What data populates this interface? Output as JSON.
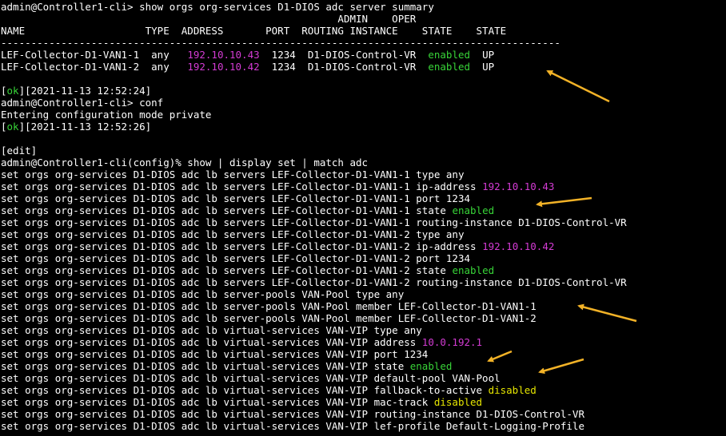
{
  "colors": {
    "background": "#000000",
    "text": "#ffffff",
    "ip_magenta": "#d33bd3",
    "enabled_green": "#38d438",
    "disabled_yellow": "#e6e600",
    "arrow_orange": "#f2b227"
  },
  "summary": {
    "command": "admin@Controller1-cli> show orgs org-services D1-DIOS adc server summary",
    "header1": "                                                        ADMIN    OPER",
    "header2": "NAME                    TYPE  ADDRESS       PORT  ROUTING INSTANCE    STATE    STATE",
    "separator": "---------------------------------------------------------------------------------------------",
    "rows": [
      {
        "name": "LEF-Collector-D1-VAN1-1  ",
        "type": "any   ",
        "address": "192.10.10.43",
        "port": "  1234  ",
        "ri": "D1-DIOS-Control-VR  ",
        "admin": "enabled",
        "oper": "  UP"
      },
      {
        "name": "LEF-Collector-D1-VAN1-2  ",
        "type": "any   ",
        "address": "192.10.10.42",
        "port": "  1234  ",
        "ri": "D1-DIOS-Control-VR  ",
        "admin": "enabled",
        "oper": "  UP"
      }
    ]
  },
  "ok1": {
    "bracket_open": "[",
    "ok": "ok",
    "rest": "][2021-11-13 12:52:24]"
  },
  "conf_cmd": "admin@Controller1-cli> conf",
  "entering": "Entering configuration mode private",
  "ok2": {
    "bracket_open": "[",
    "ok": "ok",
    "rest": "][2021-11-13 12:52:26]"
  },
  "edit": "[edit]",
  "match_cmd": "admin@Controller1-cli(config)% show | display set | match adc",
  "set_lines": [
    {
      "text": "set orgs org-services D1-DIOS adc lb servers LEF-Collector-D1-VAN1-1 type any",
      "value": "",
      "vclass": ""
    },
    {
      "text": "set orgs org-services D1-DIOS adc lb servers LEF-Collector-D1-VAN1-1 ip-address ",
      "value": "192.10.10.43",
      "vclass": "m"
    },
    {
      "text": "set orgs org-services D1-DIOS adc lb servers LEF-Collector-D1-VAN1-1 port 1234",
      "value": "",
      "vclass": ""
    },
    {
      "text": "set orgs org-services D1-DIOS adc lb servers LEF-Collector-D1-VAN1-1 state ",
      "value": "enabled",
      "vclass": "g"
    },
    {
      "text": "set orgs org-services D1-DIOS adc lb servers LEF-Collector-D1-VAN1-1 routing-instance D1-DIOS-Control-VR",
      "value": "",
      "vclass": ""
    },
    {
      "text": "set orgs org-services D1-DIOS adc lb servers LEF-Collector-D1-VAN1-2 type any",
      "value": "",
      "vclass": ""
    },
    {
      "text": "set orgs org-services D1-DIOS adc lb servers LEF-Collector-D1-VAN1-2 ip-address ",
      "value": "192.10.10.42",
      "vclass": "m"
    },
    {
      "text": "set orgs org-services D1-DIOS adc lb servers LEF-Collector-D1-VAN1-2 port 1234",
      "value": "",
      "vclass": ""
    },
    {
      "text": "set orgs org-services D1-DIOS adc lb servers LEF-Collector-D1-VAN1-2 state ",
      "value": "enabled",
      "vclass": "g"
    },
    {
      "text": "set orgs org-services D1-DIOS adc lb servers LEF-Collector-D1-VAN1-2 routing-instance D1-DIOS-Control-VR",
      "value": "",
      "vclass": ""
    },
    {
      "text": "set orgs org-services D1-DIOS adc lb server-pools VAN-Pool type any",
      "value": "",
      "vclass": ""
    },
    {
      "text": "set orgs org-services D1-DIOS adc lb server-pools VAN-Pool member LEF-Collector-D1-VAN1-1",
      "value": "",
      "vclass": ""
    },
    {
      "text": "set orgs org-services D1-DIOS adc lb server-pools VAN-Pool member LEF-Collector-D1-VAN1-2",
      "value": "",
      "vclass": ""
    },
    {
      "text": "set orgs org-services D1-DIOS adc lb virtual-services VAN-VIP type any",
      "value": "",
      "vclass": ""
    },
    {
      "text": "set orgs org-services D1-DIOS adc lb virtual-services VAN-VIP address ",
      "value": "10.0.192.1",
      "vclass": "m"
    },
    {
      "text": "set orgs org-services D1-DIOS adc lb virtual-services VAN-VIP port 1234",
      "value": "",
      "vclass": ""
    },
    {
      "text": "set orgs org-services D1-DIOS adc lb virtual-services VAN-VIP state ",
      "value": "enabled",
      "vclass": "g"
    },
    {
      "text": "set orgs org-services D1-DIOS adc lb virtual-services VAN-VIP default-pool VAN-Pool",
      "value": "",
      "vclass": ""
    },
    {
      "text": "set orgs org-services D1-DIOS adc lb virtual-services VAN-VIP fallback-to-active ",
      "value": "disabled",
      "vclass": "y"
    },
    {
      "text": "set orgs org-services D1-DIOS adc lb virtual-services VAN-VIP mac-track ",
      "value": "disabled",
      "vclass": "y"
    },
    {
      "text": "set orgs org-services D1-DIOS adc lb virtual-services VAN-VIP routing-instance D1-DIOS-Control-VR",
      "value": "",
      "vclass": ""
    },
    {
      "text": "set orgs org-services D1-DIOS adc lb virtual-services VAN-VIP lef-profile Default-Logging-Profile",
      "value": "",
      "vclass": ""
    }
  ]
}
